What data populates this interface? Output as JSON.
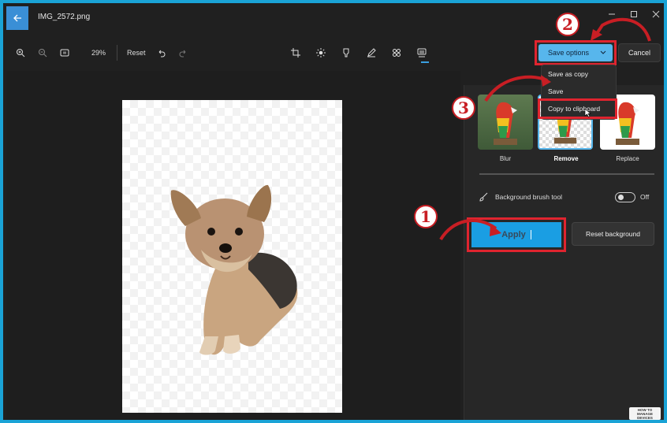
{
  "window": {
    "title": "IMG_2572.png",
    "back_icon": "arrow-left-icon",
    "controls": [
      "minimize-icon",
      "maximize-icon",
      "close-icon"
    ]
  },
  "toolbar": {
    "zoom_in_icon": "zoom-in-icon",
    "zoom_out_icon": "zoom-out-icon",
    "fit_icon": "fit-to-window-icon",
    "zoom_level": "29%",
    "reset_label": "Reset",
    "undo_icon": "undo-icon",
    "redo_icon": "redo-icon",
    "tools": [
      "crop-icon",
      "brightness-icon",
      "filter-icon",
      "markup-icon",
      "retouch-icon",
      "background-icon"
    ]
  },
  "save_options": {
    "label": "Save options",
    "cancel_label": "Cancel",
    "menu": [
      "Save as copy",
      "Save",
      "Copy to clipboard"
    ]
  },
  "background_panel": {
    "options": [
      {
        "label": "Blur",
        "selected": false
      },
      {
        "label": "Remove",
        "selected": true
      },
      {
        "label": "Replace",
        "selected": false
      }
    ],
    "brush_tool_label": "Background brush tool",
    "brush_tool_state": "Off",
    "apply_label": "Apply",
    "reset_background_label": "Reset background"
  },
  "annotations": {
    "step1": "1",
    "step2": "2",
    "step3": "3"
  },
  "watermark": {
    "line1": "HOW TO",
    "line2": "MANAGE",
    "line3": "DEVICES"
  },
  "colors": {
    "accent": "#57b6ec",
    "apply": "#1a9ee3",
    "annotation_red": "#e0242f",
    "frame_border": "#1aa3d6"
  }
}
